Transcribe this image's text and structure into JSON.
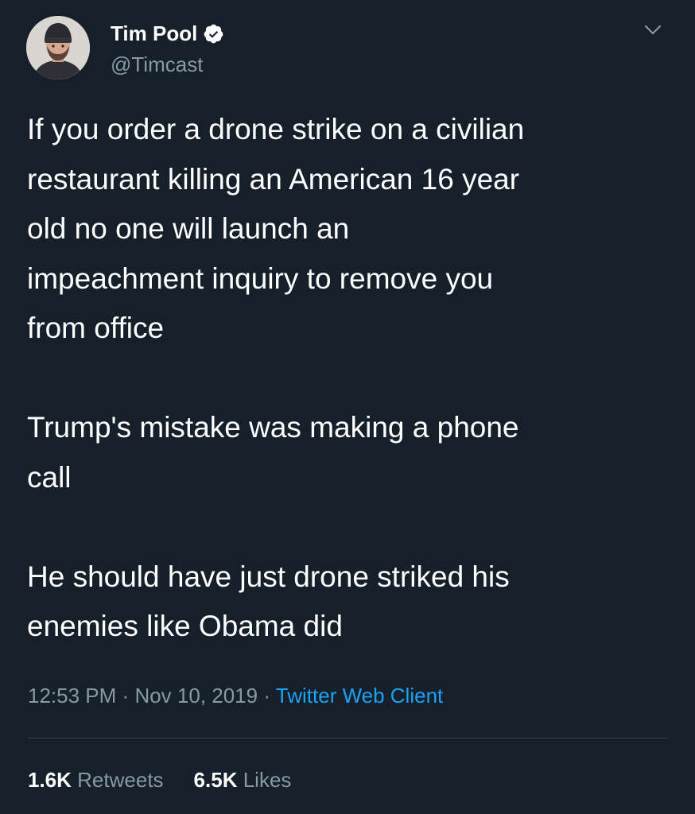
{
  "tweet": {
    "author": {
      "display_name": "Tim Pool",
      "handle": "@Timcast",
      "verified": true,
      "avatar_icon": "profile-photo"
    },
    "text": "If you order a drone strike on a civilian\nrestaurant killing an American 16 year\nold no one will launch an\nimpeachment inquiry to remove you\nfrom office\n\nTrump's mistake was making a phone\ncall\n\nHe should have just drone striked his\nenemies like Obama did",
    "time": "12:53 PM",
    "separator": "·",
    "date": "Nov 10, 2019",
    "source": "Twitter Web Client",
    "retweets_count": "1.6K",
    "retweets_label": "Retweets",
    "likes_count": "6.5K",
    "likes_label": "Likes",
    "menu_icon": "chevron-down-icon",
    "verified_icon": "verified-badge-icon"
  },
  "colors": {
    "background": "#15202b",
    "text": "#ffffff",
    "secondary": "#8899a6",
    "link": "#1da1f2",
    "divider": "#38444d"
  }
}
